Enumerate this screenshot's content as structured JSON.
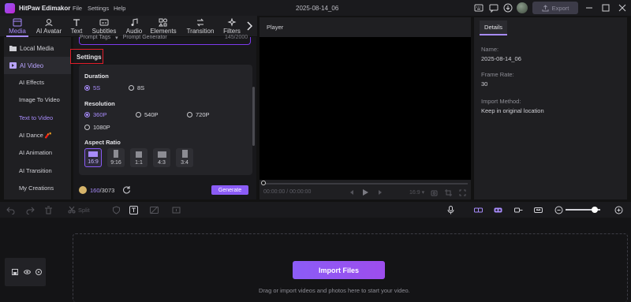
{
  "app": {
    "name": "HitPaw Edimakor",
    "project_date": "2025-08-14_06",
    "export_label": "Export"
  },
  "menu": [
    "File",
    "Settings",
    "Help"
  ],
  "toolbar": [
    {
      "label": "Media",
      "icon": "media-icon",
      "active": true
    },
    {
      "label": "AI Avatar",
      "icon": "avatar-icon"
    },
    {
      "label": "Text",
      "icon": "text-icon"
    },
    {
      "label": "Subtitles",
      "icon": "subtitles-icon"
    },
    {
      "label": "Audio",
      "icon": "audio-icon"
    },
    {
      "label": "Elements",
      "icon": "elements-icon"
    },
    {
      "label": "Transition",
      "icon": "transition-icon"
    },
    {
      "label": "Filters",
      "icon": "filters-icon"
    }
  ],
  "sidebar": {
    "items": [
      {
        "label": "Local Media",
        "icon": "folder-icon"
      },
      {
        "label": "AI Video",
        "icon": "video-icon",
        "active": true
      },
      {
        "label": "AI Effects"
      },
      {
        "label": "Image To Video"
      },
      {
        "label": "Text to Video",
        "selected": true
      },
      {
        "label": "AI Dance 🧨"
      },
      {
        "label": "AI Animation"
      },
      {
        "label": "AI Transition"
      },
      {
        "label": "My Creations"
      }
    ]
  },
  "prompt": {
    "tags_label": "Prompt Tags",
    "generator_label": "Prompt Generator",
    "char_count": "145/2000"
  },
  "settings": {
    "title": "Settings",
    "duration": {
      "label": "Duration",
      "options": [
        "5S",
        "8S"
      ],
      "selected": "5S"
    },
    "resolution": {
      "label": "Resolution",
      "options": [
        "360P",
        "540P",
        "720P",
        "1080P"
      ],
      "selected": "360P"
    },
    "aspect_ratio": {
      "label": "Aspect Ratio",
      "options": [
        "16:9",
        "9:16",
        "1:1",
        "4:3",
        "3:4"
      ],
      "selected": "16:9"
    }
  },
  "credits": {
    "used": "160",
    "total": "/3073"
  },
  "generate_label": "Generate",
  "player": {
    "title": "Player",
    "current_time": "00:00:00",
    "total_time": "/ 00:00:00",
    "ratio": "16:9"
  },
  "details": {
    "tab": "Details",
    "fields": [
      {
        "key": "Name:",
        "value": "2025-08-14_06"
      },
      {
        "key": "Frame Rate:",
        "value": "30"
      },
      {
        "key": "Import Method:",
        "value": "Keep in original location"
      }
    ]
  },
  "timeline": {
    "split_label": "Split",
    "zoom_level": 0.85
  },
  "import": {
    "button_label": "Import Files",
    "hint": "Drag or import videos and photos here to start your video."
  },
  "colors": {
    "accent": "#8b5cf6",
    "accent_light": "#a78bfa",
    "settings_highlight": "#e11d2a"
  }
}
